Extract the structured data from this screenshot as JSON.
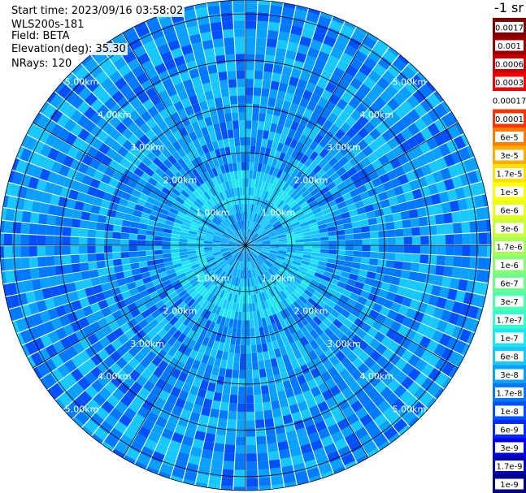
{
  "info": {
    "start_time": "Start time: 2023/09/16 03:58:02",
    "station": "WLS200s-181",
    "field": "Field: BETA",
    "elevation": "Elevation(deg): 35.30",
    "nrays": "NRays: 120"
  },
  "colorbar": {
    "unit_label": "-1 sr",
    "labels": [
      "0.0017",
      "0.001",
      "0.0006",
      "0.0003",
      "0.00017",
      "0.0001",
      "6e-5",
      "3e-5",
      "1.7e-5",
      "1e-5",
      "6e-6",
      "3e-6",
      "1.7e-6",
      "1e-6",
      "6e-7",
      "3e-7",
      "1.7e-7",
      "1e-7",
      "6e-8",
      "3e-8",
      "1.7e-8",
      "1e-8",
      "6e-9",
      "3e-9",
      "1.7e-9",
      "1e-9"
    ],
    "colors": [
      "#7f0000",
      "#9a0000",
      "#c80000",
      "#f00000",
      "#ffffff",
      "#ff3300",
      "#ff7a00",
      "#ffae00",
      "#ffe000",
      "#ffff00",
      "#e4ff1a",
      "#c8ff37",
      "#a6ff55",
      "#88ff72",
      "#6bff8c",
      "#4dffae",
      "#33ffcc",
      "#1ee6f0",
      "#16c8ff",
      "#0aa0ff",
      "#0078ff",
      "#0050ff",
      "#0028ff",
      "#0000e6",
      "#0000b4",
      "#000080"
    ]
  },
  "chart_data": {
    "type": "heatmap",
    "projection": "polar PPI",
    "field": "BETA",
    "elevation_deg": 35.3,
    "nrays": 120,
    "range_unit": "km",
    "range_max_km": 5.3,
    "range_rings_km": [
      1.0,
      2.0,
      3.0,
      4.0,
      5.0
    ],
    "range_ring_labels": [
      "1.00km",
      "2.00km",
      "3.00km",
      "4.00km",
      "5.00km"
    ],
    "azimuth_lines_deg": [
      0,
      30,
      60,
      90,
      120,
      150,
      180,
      210,
      240,
      270,
      300,
      330
    ],
    "dominant_value_range": [
      "6e-8",
      "1e-8"
    ],
    "description_colors": [
      "#1ee6f0",
      "#16c8ff",
      "#0aa0ff",
      "#0078ff",
      "#0050ff"
    ]
  }
}
